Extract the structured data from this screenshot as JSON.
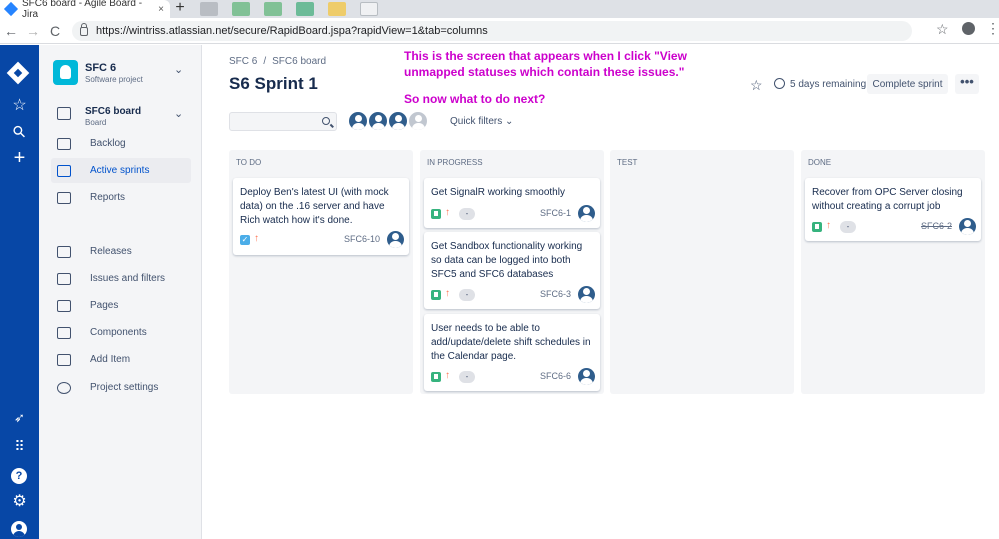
{
  "browser": {
    "tab_title": "SFC6 board - Agile Board - Jira",
    "tab_close": "×",
    "new_tab": "+",
    "back": "←",
    "forward": "→",
    "reload": "C",
    "url": "https://wintriss.atlassian.net/secure/RapidBoard.jspa?rapidView=1&tab=columns",
    "star": "☆",
    "menu": "⋮"
  },
  "global_nav": {
    "star": "☆",
    "search": "⚲",
    "create": "+",
    "apps": "⠿",
    "help": "?",
    "settings": "⚙"
  },
  "sidebar": {
    "project_name": "SFC 6",
    "project_type": "Software project",
    "board_name": "SFC6 board",
    "board_type": "Board",
    "chevron": "⌄",
    "items": [
      {
        "label": "Backlog"
      },
      {
        "label": "Active sprints"
      },
      {
        "label": "Reports"
      },
      {
        "label": "Releases"
      },
      {
        "label": "Issues and filters"
      },
      {
        "label": "Pages"
      },
      {
        "label": "Components"
      },
      {
        "label": "Add Item"
      },
      {
        "label": "Project settings"
      }
    ]
  },
  "header": {
    "breadcrumb": [
      "SFC 6",
      "SFC6 board"
    ],
    "breadcrumb_sep": "/",
    "title": "S6 Sprint 1",
    "star": "☆",
    "remaining": "5 days remaining",
    "complete_label": "Complete sprint",
    "more": "•••"
  },
  "annotation": {
    "line1": "This is the screen that appears when I click \"View unmapped statuses which contain these issues.\"",
    "line2": "So now what to do next?"
  },
  "filters": {
    "search_value": "",
    "quick_filters": "Quick filters ⌄"
  },
  "columns": [
    {
      "name": "TO DO"
    },
    {
      "name": "IN PROGRESS"
    },
    {
      "name": "TEST"
    },
    {
      "name": "DONE"
    }
  ],
  "cards": [
    {
      "summary": "Deploy Ben's latest UI (with mock data) on the .16 server and have Rich watch how it's done.",
      "key": "SFC6-10",
      "type": "task",
      "check": "✓",
      "priority": "↑",
      "estimate": ""
    },
    {
      "summary": "Get SignalR working smoothly",
      "key": "SFC6-1",
      "type": "story",
      "priority": "↑",
      "estimate": "-"
    },
    {
      "summary": "Get Sandbox functionality working so data can be logged into both SFC5 and SFC6 databases",
      "key": "SFC6-3",
      "type": "story",
      "priority": "↑",
      "estimate": "-"
    },
    {
      "summary": "User needs to be able to add/update/delete shift schedules in the Calendar page.",
      "key": "SFC6-6",
      "type": "story",
      "priority": "↑",
      "estimate": "-"
    },
    {
      "summary": "Recover from OPC Server closing without creating a corrupt job",
      "key": "SFC6-2",
      "type": "story",
      "priority": "↑",
      "estimate": "-"
    }
  ]
}
